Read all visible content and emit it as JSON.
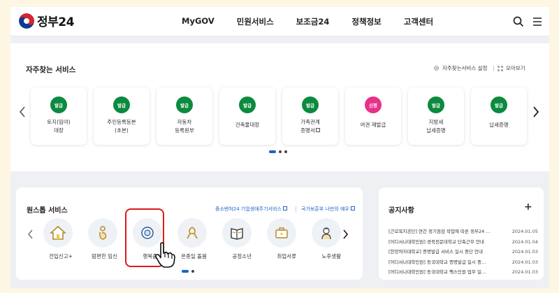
{
  "header": {
    "logo": "정부24",
    "nav": [
      "MyGOV",
      "민원서비스",
      "보조금24",
      "정책정보",
      "고객센터"
    ],
    "search_icon": "search-icon",
    "menu_icon": "hamburger-menu-icon"
  },
  "favorites": {
    "title": "자주찾는 서비스",
    "settings_label": "자주찾는서비스 설정",
    "view_all_label": "모아보기",
    "cards": [
      {
        "badge": "발급",
        "line1": "토지(임야)",
        "line2": "대장",
        "color": "#0c8a3f"
      },
      {
        "badge": "발급",
        "line1": "주민등록등본",
        "line2": "(초본)",
        "color": "#0c8a3f"
      },
      {
        "badge": "발급",
        "line1": "자동차",
        "line2": "등록원부",
        "color": "#0c8a3f"
      },
      {
        "badge": "발급",
        "line1": "건축물대장",
        "line2": "",
        "color": "#0c8a3f"
      },
      {
        "badge": "발급",
        "line1": "가족관계",
        "line2": "증명서",
        "color": "#0c8a3f"
      },
      {
        "badge": "신청",
        "line1": "여권 재발급",
        "line2": "",
        "color": "#e8308a"
      },
      {
        "badge": "발급",
        "line1": "지방세",
        "line2": "납세증명",
        "color": "#0c8a3f"
      },
      {
        "badge": "발급",
        "line1": "납세증명",
        "line2": "",
        "color": "#0c8a3f"
      }
    ]
  },
  "onestop": {
    "title": "원스톱 서비스",
    "link1": "중소벤처24 기업생애주기서비스",
    "link2": "국가보훈부 나만의 예우",
    "services": [
      {
        "label": "전입신고+",
        "icon": "house-icon"
      },
      {
        "label": "맘편한 임신",
        "icon": "pregnancy-icon"
      },
      {
        "label": "행복출산",
        "icon": "baby-icon"
      },
      {
        "label": "온종일 돌봄",
        "icon": "care-ribbon-icon"
      },
      {
        "label": "공정소년",
        "icon": "book-icon"
      },
      {
        "label": "취업서류",
        "icon": "briefcase-icon"
      },
      {
        "label": "노후생활",
        "icon": "elder-icon"
      }
    ]
  },
  "notice": {
    "title": "공지사항",
    "items": [
      {
        "text": "[근로복지공단] 연간 정기점검 작업에 따른 정부24 …",
        "date": "2024.01.05"
      },
      {
        "text": "[어디서나대학민원] 경북전문대학교 단축근무 안내",
        "date": "2024.01.04"
      },
      {
        "text": "[한양여자대학교] 증명발급 서비스 일시 중단 안내",
        "date": "2024.01.03"
      },
      {
        "text": "[어디서나대학민원] 동국대학교 증명발급 일시 중…",
        "date": "2024.01.03"
      },
      {
        "text": "[어디서나대학민원] 동국대학교 팩스민원 업무 일…",
        "date": "2024.01.03"
      }
    ]
  }
}
